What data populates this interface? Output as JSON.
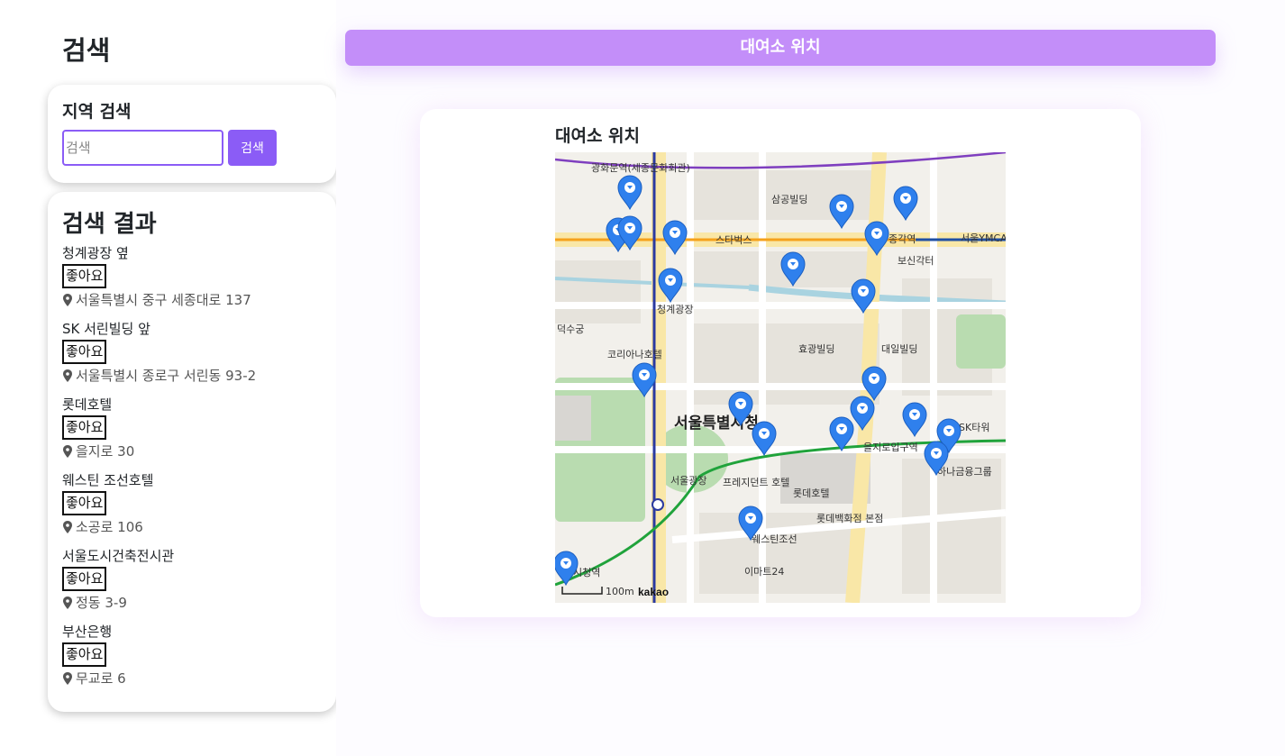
{
  "sidebar": {
    "title": "검색",
    "search": {
      "heading": "지역 검색",
      "placeholder": "검색",
      "button_label": "검색"
    },
    "results": {
      "heading": "검색 결과",
      "like_label": "좋아요",
      "items": [
        {
          "name": "청계광장 옆",
          "address": "서울특별시 중구 세종대로 137"
        },
        {
          "name": "SK 서린빌딩 앞",
          "address": "서울특별시 종로구 서린동 93-2"
        },
        {
          "name": "롯데호텔",
          "address": "을지로 30"
        },
        {
          "name": "웨스틴 조선호텔",
          "address": "소공로 106"
        },
        {
          "name": "서울도시건축전시관",
          "address": "정동 3-9"
        },
        {
          "name": "부산은행",
          "address": "무교로 6"
        }
      ]
    }
  },
  "banner": {
    "title": "대여소 위치"
  },
  "map": {
    "title": "대여소 위치",
    "scale_label": "100m",
    "brand": "kakao",
    "marker_color": "#2f80ed",
    "labels": {
      "city_hall": "서울특별시청",
      "sejong_station": "광화문역(세종문화회관)",
      "cheonggye_plaza": "청계광장",
      "euljiro_station": "을지로입구역",
      "city_hall_station": "시청역",
      "lotte_hotel": "롯데호텔",
      "westin": "웨스틴조선",
      "seoul_plaza": "서울광장",
      "starbucks": "스타벅스",
      "lotte_dept": "롯데백화점 본점",
      "deoksu": "덕수궁",
      "sk_tower": "SK타워",
      "hana_bank": "하나금융그룹",
      "plaza_hotel": "프레지던트 호텔",
      "emart": "이마트24",
      "jonggak": "종각역",
      "bosingak": "보신각터",
      "ymca": "서울YMCA",
      "koreana": "코리아나호텔",
      "samgong": "삼공빌딩",
      "daeil": "대일빌딩",
      "hyokwang": "효광빌딩",
      "sinhan": "서울도시 건축전시관"
    }
  }
}
